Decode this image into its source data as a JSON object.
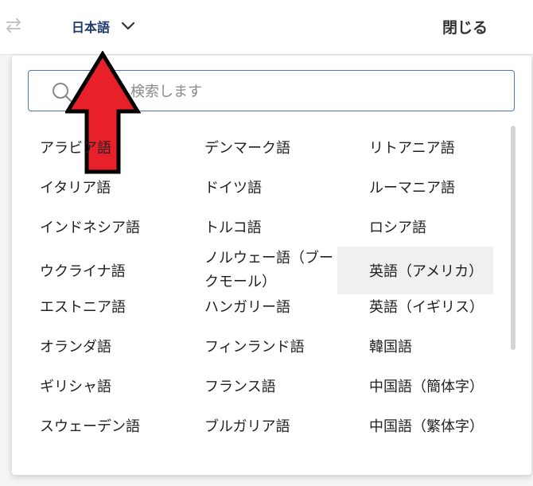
{
  "header": {
    "source_language": "日本語",
    "close_label": "閉じる"
  },
  "search": {
    "placeholder": "検索します",
    "value": ""
  },
  "languages": {
    "col1": [
      "アラビア語",
      "イタリア語",
      "インドネシア語",
      "ウクライナ語",
      "エストニア語",
      "オランダ語",
      "ギリシャ語",
      "スウェーデン語"
    ],
    "col2": [
      "デンマーク語",
      "ドイツ語",
      "トルコ語",
      "ノルウェー語（ブークモール）",
      "ハンガリー語",
      "フィンランド語",
      "フランス語",
      "ブルガリア語"
    ],
    "col3": [
      "リトアニア語",
      "ルーマニア語",
      "ロシア語",
      "英語（アメリカ）",
      "英語（イギリス）",
      "韓国語",
      "中国語（簡体字）",
      "中国語（繁体字）"
    ]
  },
  "colors": {
    "accent": "#1f3a6e",
    "search_border": "#4a7bb0",
    "arrow_fill": "#e8202a"
  },
  "icons": [
    "swap-icon",
    "chevron-down-icon",
    "search-icon",
    "annotation-arrow-icon"
  ]
}
